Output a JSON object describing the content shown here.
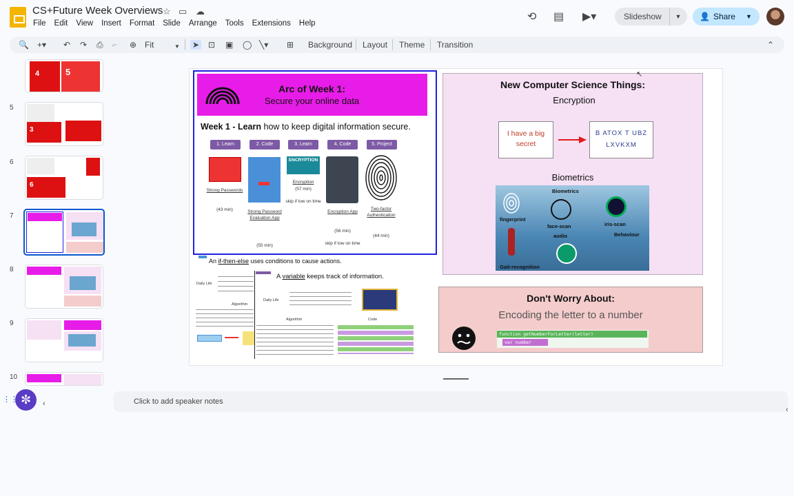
{
  "app": {
    "title": "CS+Future Week Overviews",
    "menu": [
      "File",
      "Edit",
      "View",
      "Insert",
      "Format",
      "Slide",
      "Arrange",
      "Tools",
      "Extensions",
      "Help"
    ],
    "slideshow_label": "Slideshow",
    "share_label": "Share"
  },
  "toolbar": {
    "zoom": "Fit",
    "background": "Background",
    "layout": "Layout",
    "theme": "Theme",
    "transition": "Transition"
  },
  "filmstrip": {
    "slides": [
      {
        "num": "",
        "badge": "5"
      },
      {
        "num": "5",
        "badge": "3"
      },
      {
        "num": "6",
        "badge": "6"
      },
      {
        "num": "7",
        "badge": ""
      },
      {
        "num": "8",
        "badge": ""
      },
      {
        "num": "9",
        "badge": ""
      },
      {
        "num": "10",
        "badge": ""
      }
    ],
    "top_partial_badge": "4",
    "selected": "7"
  },
  "slide": {
    "arc": {
      "title": "Arc of Week 1:",
      "subtitle": "Secure your online data",
      "week_bold": "Week 1 - Learn",
      "week_rest": " how to keep digital information secure.",
      "steps": [
        "1. Learn",
        "2. Code",
        "3. Learn",
        "4. Code",
        "5. Project"
      ],
      "cards": [
        {
          "caption": "Strong Passwords",
          "time": "(43 min)"
        },
        {
          "caption": "Strong Password Evaluation App",
          "time": "(55 min)"
        },
        {
          "caption": "Encryption",
          "time": "(57 min)",
          "note": "skip if low on time",
          "banner": "ENCRYPTION"
        },
        {
          "caption": "Encryption App",
          "time": "(56 min)",
          "note": "skip if low on time"
        },
        {
          "caption": "Two-factor Authentication",
          "time": "(44 min)"
        }
      ]
    },
    "cs": {
      "title": "New Computer Science Things:",
      "encryption_label": "Encryption",
      "plain_text": "I have a big secret",
      "cipher_text": "B ATOX T UBZ LXVKXM",
      "biometrics_label": "Biometrics",
      "bio_items": [
        "Biometrics",
        "fingerprint",
        "face-scan",
        "iris-scan",
        "audio",
        "Behaviour",
        "Gait-recognition"
      ]
    },
    "worry": {
      "title": "Don't Worry About:",
      "subtitle": "Encoding the letter to a number",
      "code_line1": "function getNumberForLetter(letter)",
      "code_line2": "var number"
    },
    "concepts": {
      "ifthen_pre": "An ",
      "ifthen_link": "if-then-else",
      "ifthen_post": " uses conditions to cause actions.",
      "var_pre": "A ",
      "var_link": "variable",
      "var_post": " keeps track of information.",
      "daily_life": "Daily Life",
      "algorithm": "Algorithm",
      "code": "Code"
    }
  },
  "notes_placeholder": "Click to add speaker notes",
  "colors": {
    "magenta": "#e81ce8",
    "accent_blue": "#0b57d0",
    "share_bg": "#c2e7ff"
  }
}
